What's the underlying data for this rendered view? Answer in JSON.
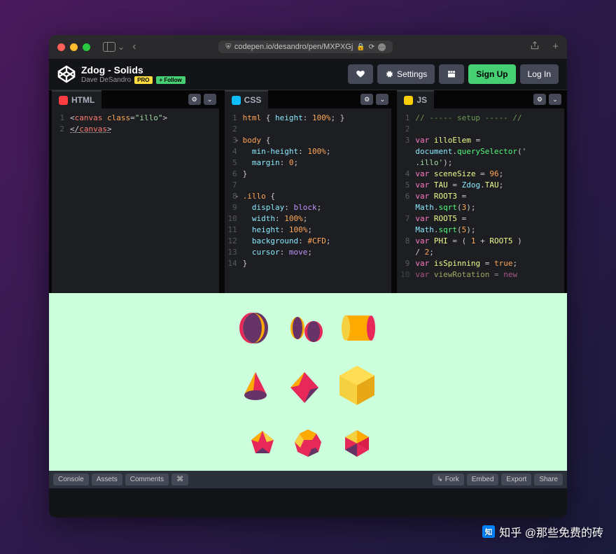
{
  "browser": {
    "url_text": "codepen.io/desandro/pen/MXPXGj"
  },
  "pen": {
    "title": "Zdog - Solids",
    "author": "Dave DeSandro",
    "pro_label": "PRO",
    "follow_label": "+ Follow"
  },
  "header_actions": {
    "settings": "Settings",
    "signup": "Sign Up",
    "login": "Log In"
  },
  "panels": {
    "html": {
      "label": "HTML"
    },
    "css": {
      "label": "CSS"
    },
    "js": {
      "label": "JS"
    }
  },
  "code": {
    "html": [
      {
        "ln": "1",
        "raw": "<canvas class=\"illo\">"
      },
      {
        "ln": "2",
        "raw": "</canvas>"
      }
    ],
    "css": [
      {
        "ln": "1",
        "raw": "html { height: 100%; }"
      },
      {
        "ln": "2",
        "raw": ""
      },
      {
        "ln": "3",
        "raw": "body {"
      },
      {
        "ln": "4",
        "raw": "  min-height: 100%;"
      },
      {
        "ln": "5",
        "raw": "  margin: 0;"
      },
      {
        "ln": "6",
        "raw": "}"
      },
      {
        "ln": "7",
        "raw": ""
      },
      {
        "ln": "8",
        "raw": ".illo {"
      },
      {
        "ln": "9",
        "raw": "  display: block;"
      },
      {
        "ln": "10",
        "raw": "  width: 100%;"
      },
      {
        "ln": "11",
        "raw": "  height: 100%;"
      },
      {
        "ln": "12",
        "raw": "  background: #CFD;"
      },
      {
        "ln": "13",
        "raw": "  cursor: move;"
      },
      {
        "ln": "14",
        "raw": "}"
      }
    ],
    "js": [
      {
        "ln": "1",
        "raw": "// ----- setup ----- //"
      },
      {
        "ln": "2",
        "raw": ""
      },
      {
        "ln": "3",
        "raw": "var illoElem = document.querySelector('.illo');"
      },
      {
        "ln": "4",
        "raw": "var sceneSize = 96;"
      },
      {
        "ln": "5",
        "raw": "var TAU = Zdog.TAU;"
      },
      {
        "ln": "6",
        "raw": "var ROOT3 = Math.sqrt(3);"
      },
      {
        "ln": "7",
        "raw": "var ROOT5 = Math.sqrt(5);"
      },
      {
        "ln": "8",
        "raw": "var PHI = ( 1 + ROOT5 ) / 2;"
      },
      {
        "ln": "9",
        "raw": "var isSpinning = true;"
      },
      {
        "ln": "10",
        "raw": "var viewRotation = new"
      }
    ]
  },
  "footer": {
    "console": "Console",
    "assets": "Assets",
    "comments": "Comments",
    "shortcut": "⌘",
    "fork": "Fork",
    "embed": "Embed",
    "export": "Export",
    "share": "Share"
  },
  "watermark": "知乎 @那些免费的砖"
}
